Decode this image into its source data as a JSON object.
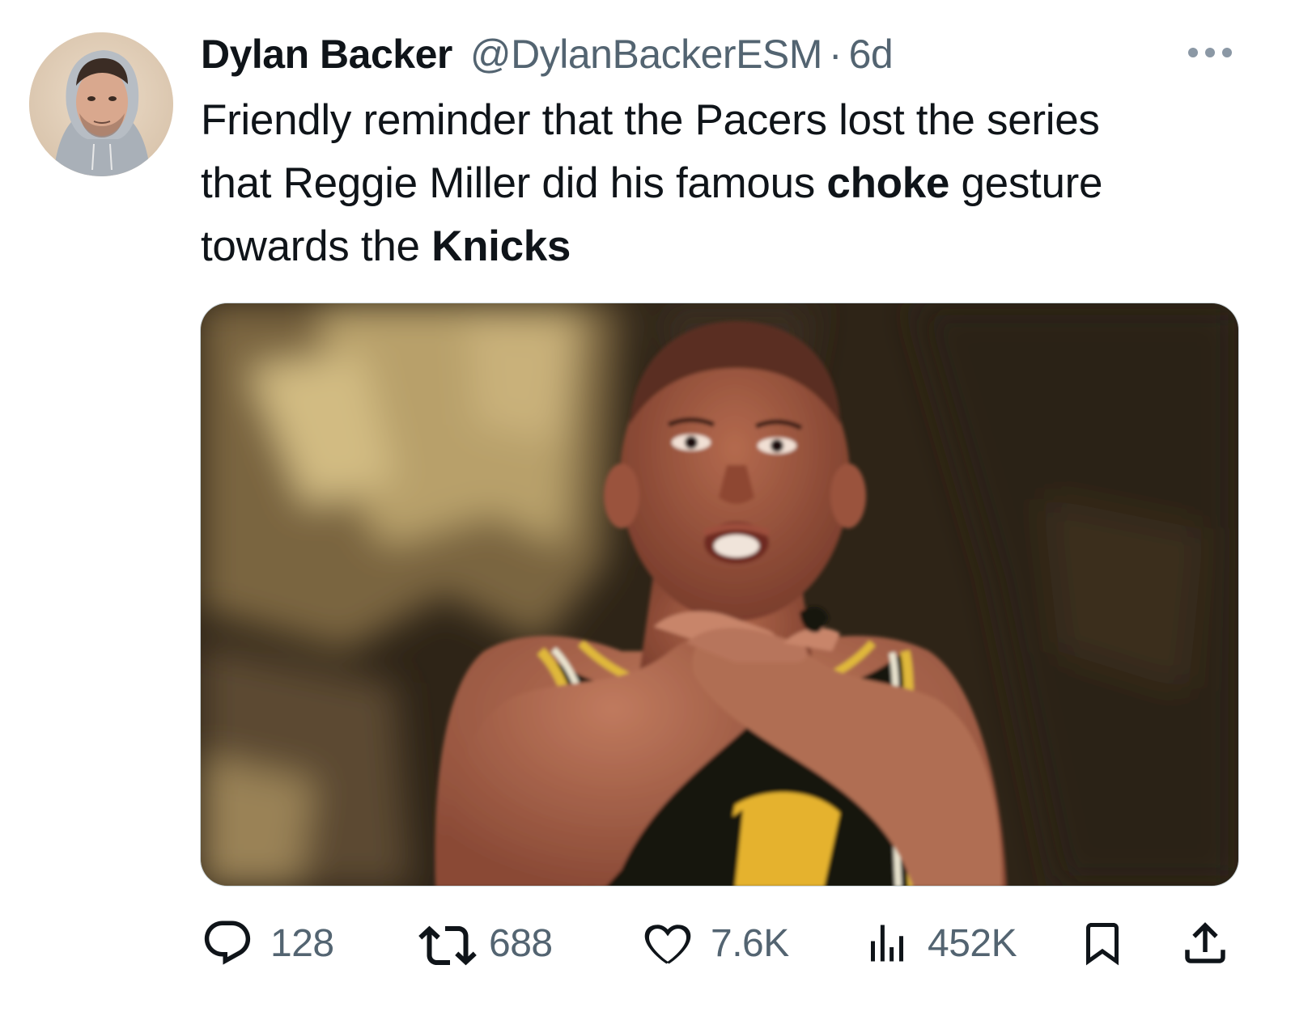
{
  "author": {
    "display_name": "Dylan Backer",
    "handle": "@DylanBackerESM",
    "separator": "·",
    "time": "6d"
  },
  "tweet": {
    "line1": "Friendly reminder that the Pacers lost the series",
    "line2_a": "that Reggie Miller did his famous ",
    "line2_bold": "choke",
    "line2_b": " gesture",
    "line3_a": "towards the ",
    "line3_bold": "Knicks"
  },
  "metrics": {
    "replies": "128",
    "retweets": "688",
    "likes": "7.6K",
    "views": "452K"
  },
  "icons": {
    "more": "more-icon",
    "reply": "reply-icon",
    "retweet": "retweet-icon",
    "like": "heart-icon",
    "views": "views-icon",
    "bookmark": "bookmark-icon",
    "share": "share-icon"
  },
  "colors": {
    "text": "#0f1419",
    "secondary": "#536471",
    "background": "#ffffff"
  }
}
